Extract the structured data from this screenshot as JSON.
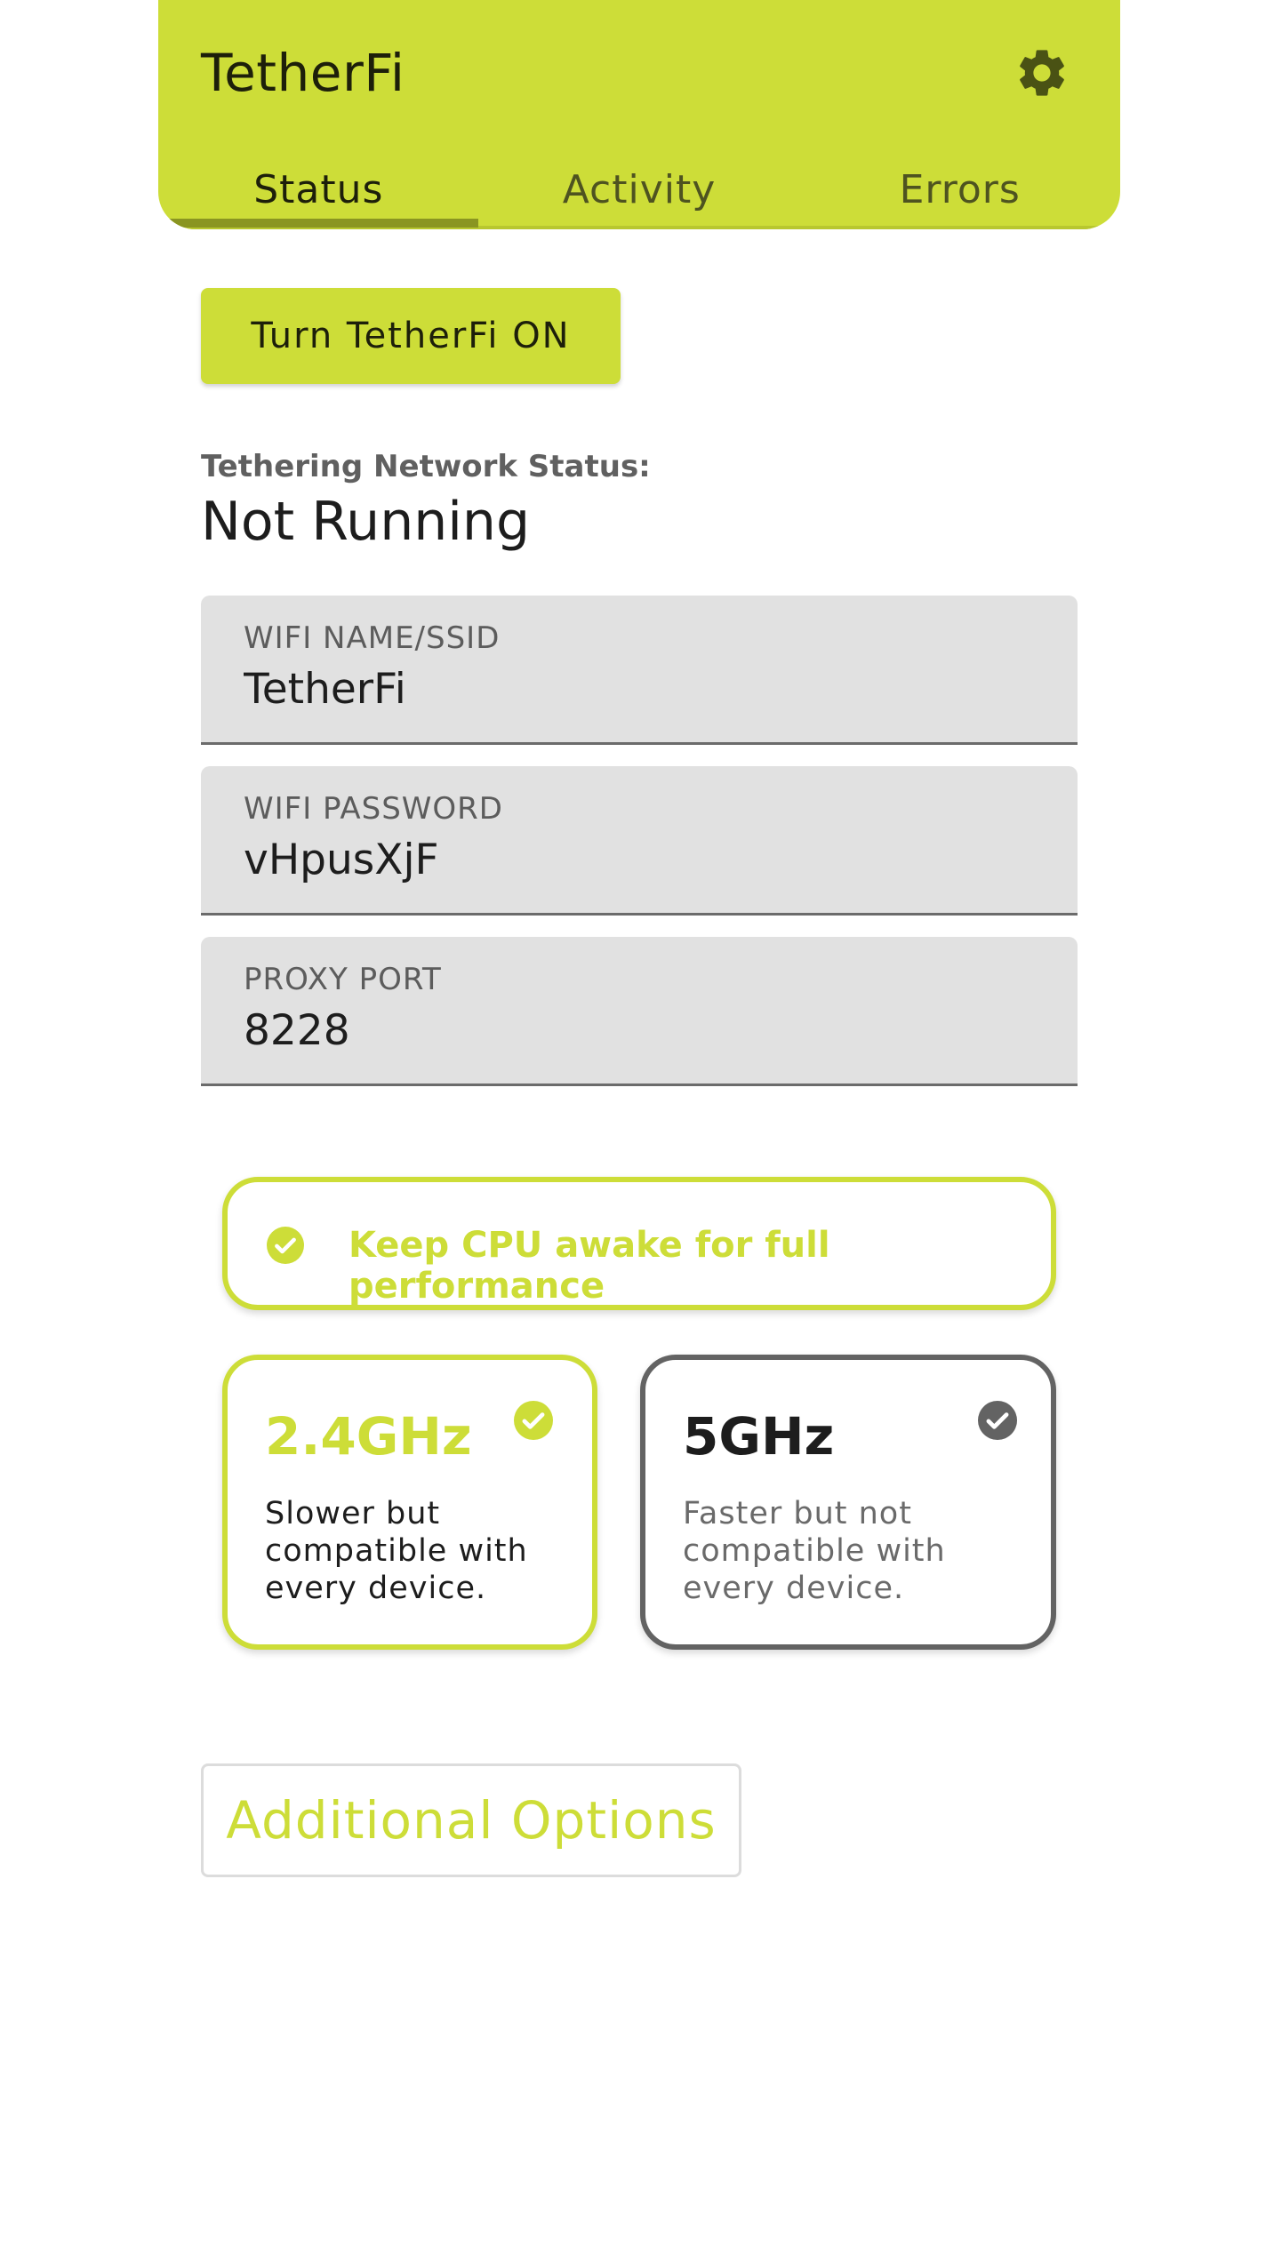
{
  "app": {
    "title": "TetherFi",
    "settings_icon": "gear-icon"
  },
  "tabs": [
    {
      "label": "Status",
      "active": true
    },
    {
      "label": "Activity",
      "active": false
    },
    {
      "label": "Errors",
      "active": false
    }
  ],
  "main": {
    "toggle_button_label": "Turn TetherFi ON",
    "status_label": "Tethering Network Status:",
    "status_value": "Not Running"
  },
  "fields": {
    "ssid": {
      "label": "WIFI NAME/SSID",
      "value": "TetherFi"
    },
    "password": {
      "label": "WIFI PASSWORD",
      "value": "vHpusXjF"
    },
    "port": {
      "label": "PROXY PORT",
      "value": "8228"
    }
  },
  "wakelock": {
    "label": "Keep CPU awake for full performance",
    "icon": "check-circle-icon",
    "enabled": true
  },
  "bands": [
    {
      "title": "2.4GHz",
      "description": "Slower but compatible with every device.",
      "selected": true,
      "icon": "check-circle-icon"
    },
    {
      "title": "5GHz",
      "description": "Faster but not compatible with every device.",
      "selected": false,
      "icon": "check-circle-icon"
    }
  ],
  "additional_options_label": "Additional Options",
  "colors": {
    "accent": "#cddd38",
    "accent_dark": "#8a9521",
    "field_bg": "#e1e1e1",
    "unselected_border": "#636363"
  }
}
